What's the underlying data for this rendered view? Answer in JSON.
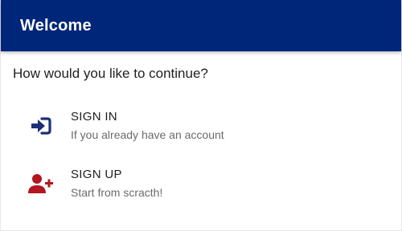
{
  "header": {
    "title": "Welcome"
  },
  "prompt": "How would you like to continue?",
  "options": [
    {
      "title": "SIGN IN",
      "subtitle": "If you already have an account",
      "icon": "sign-in-icon",
      "icon_color": "#1a2f7a"
    },
    {
      "title": "SIGN UP",
      "subtitle": "Start from scracth!",
      "icon": "add-user-icon",
      "icon_color": "#b3161e"
    }
  ],
  "colors": {
    "header_bg": "#00267a",
    "header_text": "#ffffff"
  }
}
